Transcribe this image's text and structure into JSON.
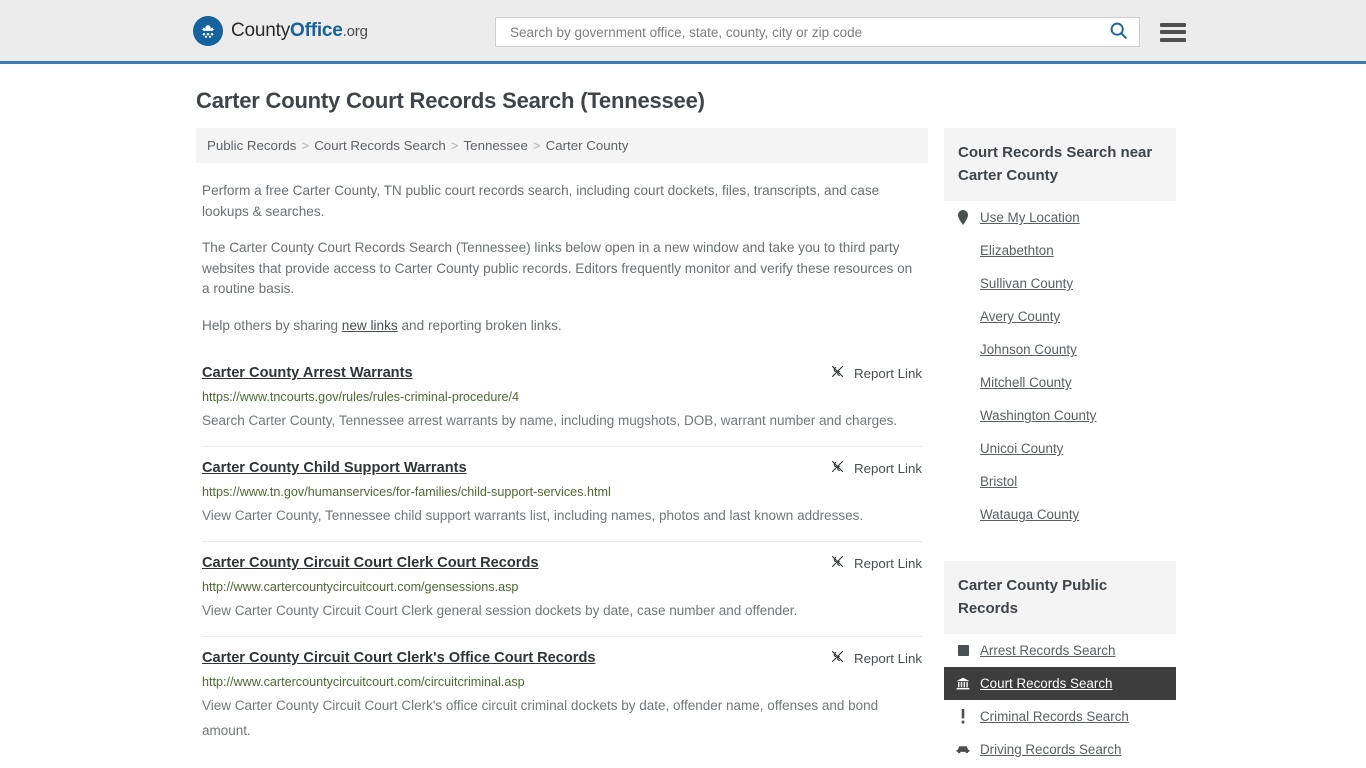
{
  "header": {
    "logo": {
      "county": "County",
      "office": "Office",
      "org": ".org",
      "icon": "eagle-seal-icon"
    },
    "search": {
      "placeholder": "Search by government office, state, county, city or zip code",
      "value": "",
      "search_icon": "search-icon"
    },
    "menu_icon": "hamburger-menu-icon",
    "accent_color": "#3d7ab0",
    "background_color": "#ececec"
  },
  "page": {
    "title": "Carter County Court Records Search (Tennessee)"
  },
  "breadcrumb": {
    "separator": ">",
    "items": [
      {
        "label": "Public Records"
      },
      {
        "label": "Court Records Search"
      },
      {
        "label": "Tennessee"
      },
      {
        "label": "Carter County"
      }
    ]
  },
  "intro": {
    "p1": "Perform a free Carter County, TN public court records search, including court dockets, files, transcripts, and case lookups & searches.",
    "p2": "The Carter County Court Records Search (Tennessee) links below open in a new window and take you to third party websites that provide access to Carter County public records. Editors frequently monitor and verify these resources on a routine basis.",
    "p3_before": "Help others by sharing ",
    "p3_link": "new links",
    "p3_after": " and reporting broken links."
  },
  "results": {
    "report_label": "Report Link",
    "report_icon": "broken-link-icon",
    "items": [
      {
        "title": "Carter County Arrest Warrants",
        "url": "https://www.tncourts.gov/rules/rules-criminal-procedure/4",
        "description": "Search Carter County, Tennessee arrest warrants by name, including mugshots, DOB, warrant number and charges."
      },
      {
        "title": "Carter County Child Support Warrants",
        "url": "https://www.tn.gov/humanservices/for-families/child-support-services.html",
        "description": "View Carter County, Tennessee child support warrants list, including names, photos and last known addresses."
      },
      {
        "title": "Carter County Circuit Court Clerk Court Records",
        "url": "http://www.cartercountycircuitcourt.com/gensessions.asp",
        "description": "View Carter County Circuit Court Clerk general session dockets by date, case number and offender."
      },
      {
        "title": "Carter County Circuit Court Clerk's Office Court Records",
        "url": "http://www.cartercountycircuitcourt.com/circuitcriminal.asp",
        "description": "View Carter County Circuit Court Clerk's office circuit criminal dockets by date, offender name, offenses and bond amount."
      }
    ]
  },
  "sidebar": {
    "nearby": {
      "heading": "Court Records Search near Carter County",
      "use_location": {
        "label": "Use My Location",
        "icon": "map-pin-icon"
      },
      "items": [
        {
          "label": "Elizabethton"
        },
        {
          "label": "Sullivan County"
        },
        {
          "label": "Avery County"
        },
        {
          "label": "Johnson County"
        },
        {
          "label": "Mitchell County"
        },
        {
          "label": "Washington County"
        },
        {
          "label": "Unicoi County"
        },
        {
          "label": "Bristol"
        },
        {
          "label": "Watauga County"
        }
      ]
    },
    "public_records": {
      "heading": "Carter County Public Records",
      "active_color": "#3d3d3d",
      "items": [
        {
          "label": "Arrest Records Search",
          "icon": "square-badge-icon",
          "active": false
        },
        {
          "label": "Court Records Search",
          "icon": "courthouse-icon",
          "active": true
        },
        {
          "label": "Criminal Records Search",
          "icon": "exclamation-icon",
          "active": false
        },
        {
          "label": "Driving Records Search",
          "icon": "car-icon",
          "active": false
        }
      ]
    }
  }
}
